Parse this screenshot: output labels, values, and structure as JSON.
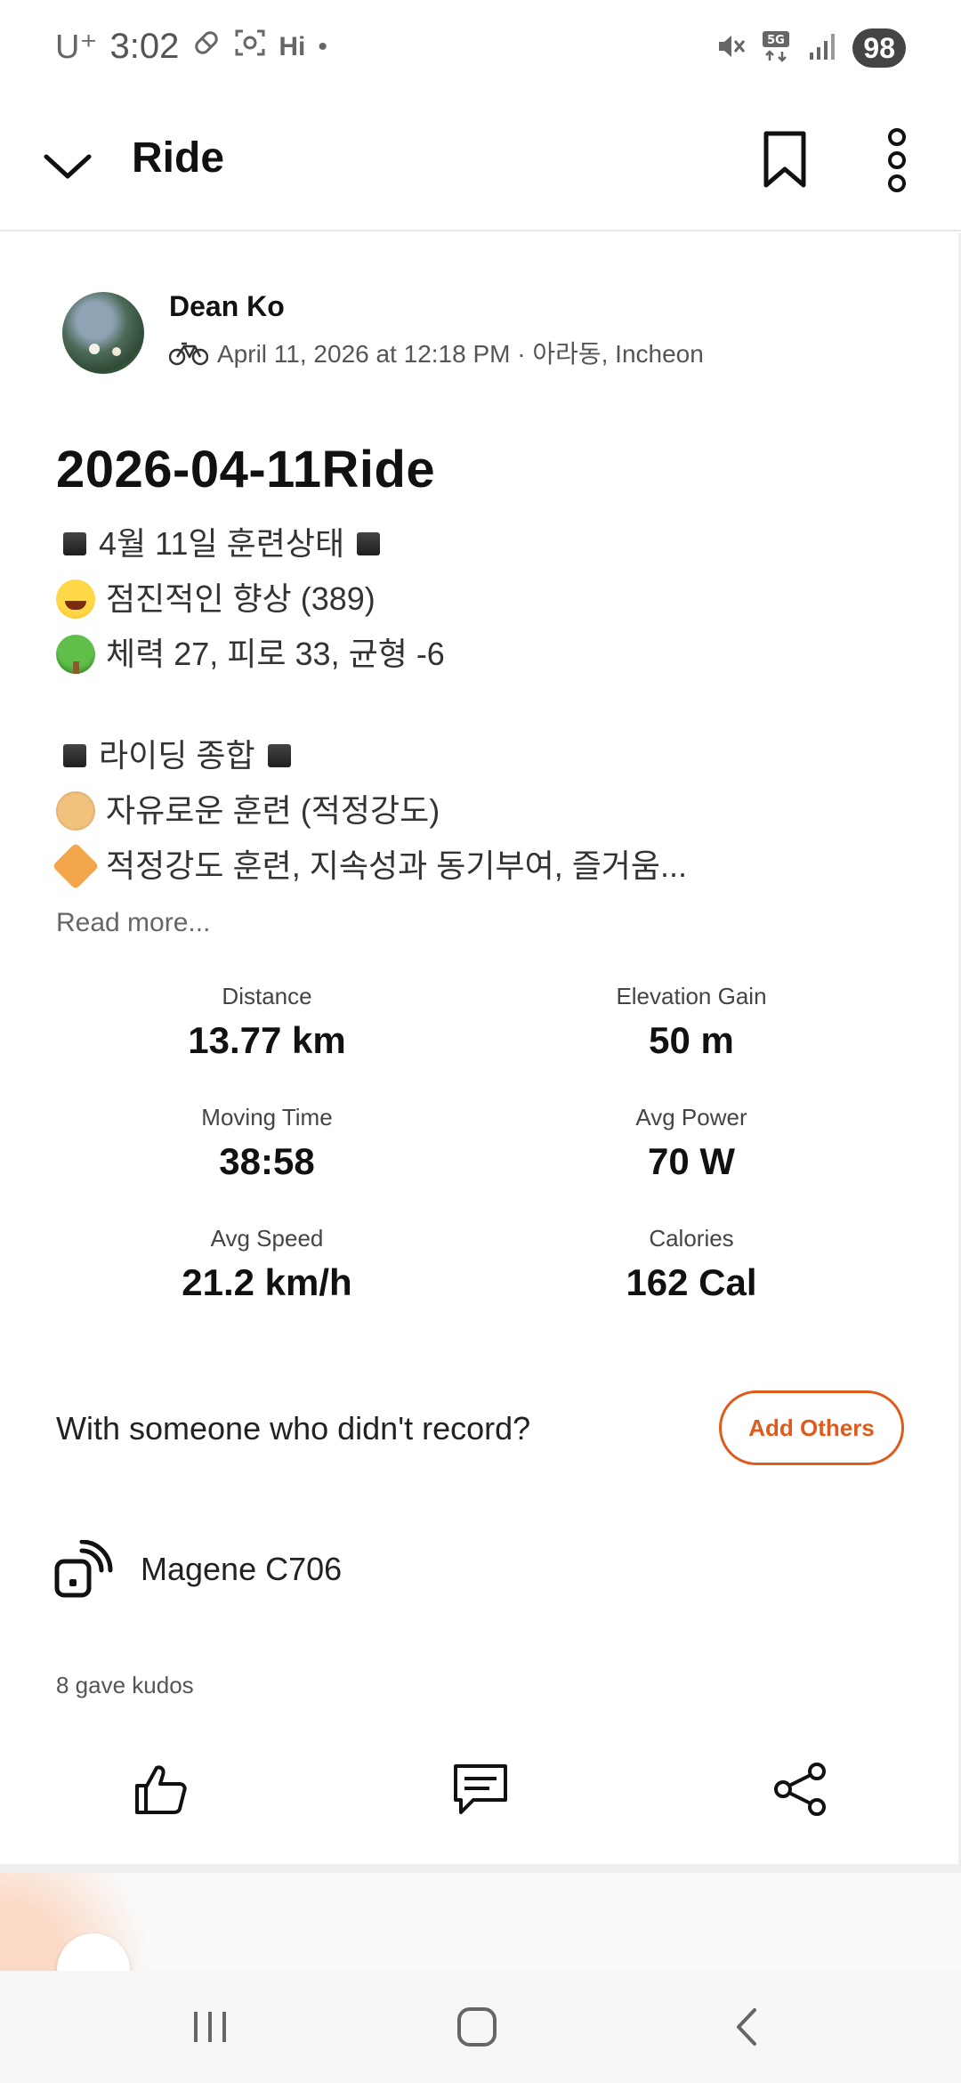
{
  "status_bar": {
    "carrier": "U⁺",
    "time": "3:02",
    "battery": "98",
    "icons": [
      "pill-icon",
      "screenshot-icon",
      "hi-icon",
      "dot-icon",
      "mute-icon",
      "5g-icon",
      "signal-icon"
    ],
    "hi_text": "Hi"
  },
  "app_bar": {
    "title": "Ride"
  },
  "post": {
    "user_name": "Dean Ko",
    "meta": "April 11, 2026 at 12:18 PM · 아라동, Incheon",
    "title": "2026-04-11Ride",
    "description": [
      {
        "emoji": "sq",
        "text": "4월 11일 훈련상태",
        "trailing_sq": true
      },
      {
        "emoji": "face",
        "text": "점진적인 향상 (389)"
      },
      {
        "emoji": "tree",
        "text": "체력 27, 피로 33, 균형 -6"
      },
      {
        "emoji": "gap",
        "text": ""
      },
      {
        "emoji": "sq",
        "text": "라이딩 종합",
        "trailing_sq": true
      },
      {
        "emoji": "dog",
        "text": "자유로운 훈련 (적정강도)"
      },
      {
        "emoji": "tag",
        "text": "적정강도 훈련, 지속성과 동기부여, 즐거움..."
      }
    ],
    "read_more": "Read more..."
  },
  "stats": [
    {
      "label": "Distance",
      "value": "13.77 km"
    },
    {
      "label": "Elevation Gain",
      "value": "50 m"
    },
    {
      "label": "Moving Time",
      "value": "38:58"
    },
    {
      "label": "Avg Power",
      "value": "70 W"
    },
    {
      "label": "Avg Speed",
      "value": "21.2 km/h"
    },
    {
      "label": "Calories",
      "value": "162 Cal"
    }
  ],
  "with_others": {
    "prompt": "With someone who didn't record?",
    "button": "Add Others"
  },
  "device": {
    "name": "Magene C706"
  },
  "kudos": {
    "text": "8 gave kudos"
  },
  "colors": {
    "accent": "#e05a1b",
    "text": "#111111",
    "muted": "#555555"
  }
}
